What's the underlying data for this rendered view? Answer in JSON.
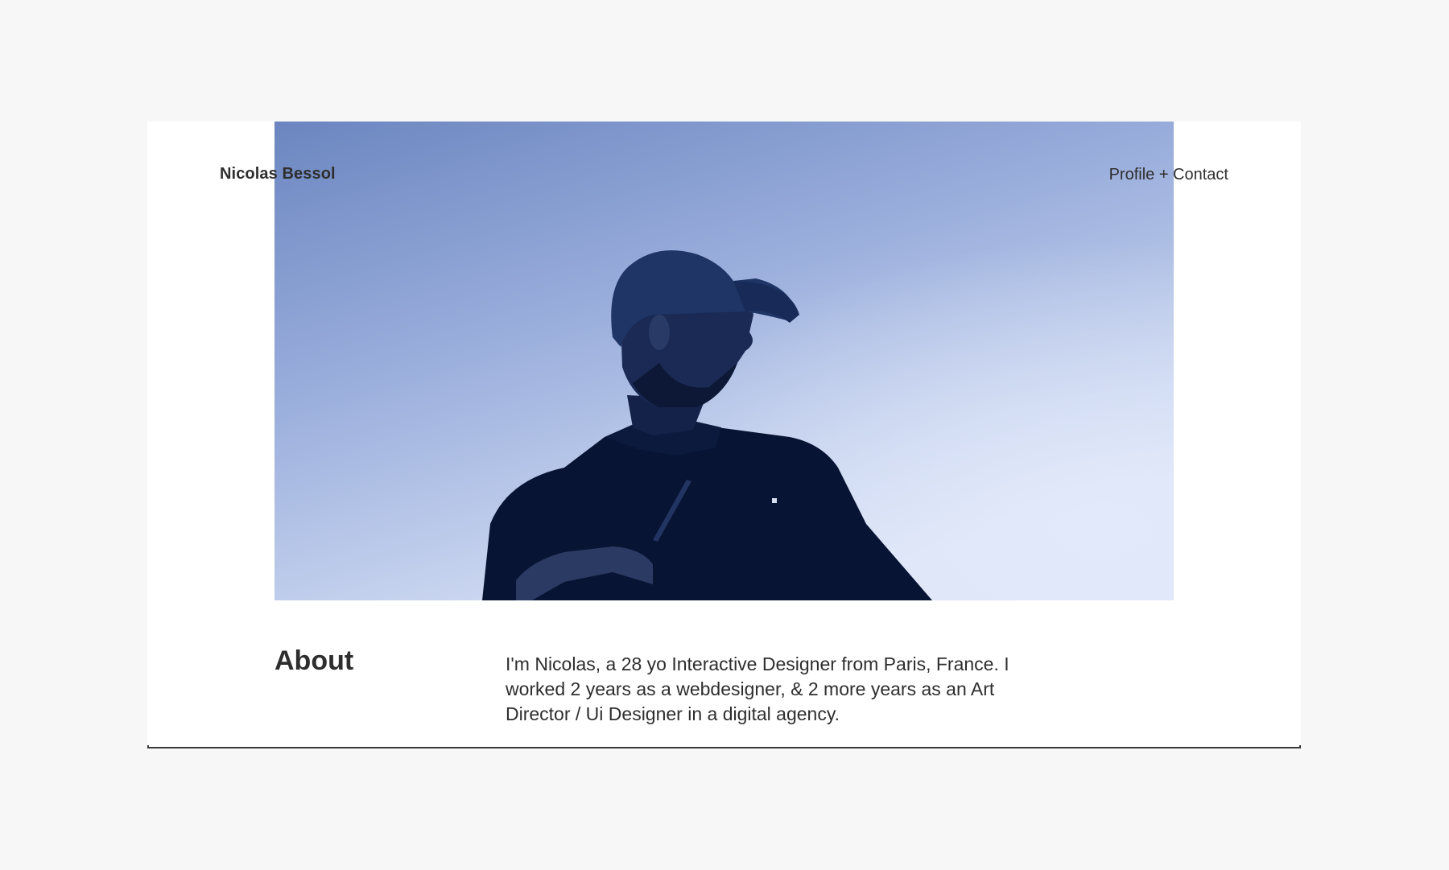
{
  "header": {
    "brand": "Nicolas Bessol",
    "nav_link": "Profile + Contact"
  },
  "hero": {
    "image_alt": "Portrait of a man in a cap against a blue sky"
  },
  "about": {
    "heading": "About",
    "text": "I'm Nicolas, a 28 yo Interactive Designer from Paris, France. I worked 2 years as a webdesigner, & 2 more years as an Art Director / Ui Designer in a digital agency."
  },
  "colors": {
    "page_background": "#f7f7f7",
    "card_background": "#ffffff",
    "text": "#2e2e2e",
    "sky_top": "#6b87c0",
    "sky_bottom": "#dbe4f8",
    "silhouette": "#0a1636"
  }
}
